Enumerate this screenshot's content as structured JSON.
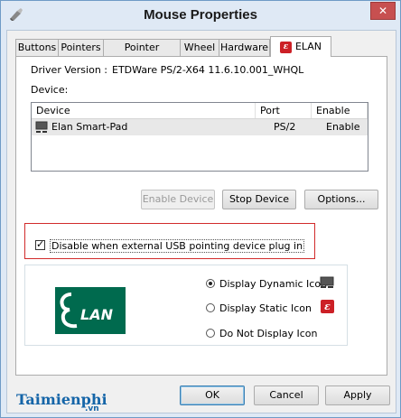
{
  "window": {
    "title": "Mouse Properties",
    "close_glyph": "✕"
  },
  "tabs": [
    {
      "label": "Buttons"
    },
    {
      "label": "Pointers"
    },
    {
      "label": "Pointer Options"
    },
    {
      "label": "Wheel"
    },
    {
      "label": "Hardware"
    },
    {
      "label": "ELAN",
      "icon": "elan-icon",
      "active": true
    }
  ],
  "driver": {
    "label": "Driver Version :",
    "value": "ETDWare PS/2-X64 11.6.10.001_WHQL"
  },
  "device_label": "Device:",
  "device_list": {
    "columns": [
      "Device",
      "Port",
      "Enable"
    ],
    "rows": [
      {
        "device": "Elan Smart-Pad",
        "port": "PS/2",
        "enable": "Enable",
        "icon": "touchpad-icon"
      }
    ]
  },
  "buttons": {
    "enable_device": "Enable Device",
    "stop_device": "Stop Device",
    "options": "Options..."
  },
  "disable_usb": {
    "label": "Disable when external USB pointing device plug in",
    "checked": true
  },
  "icon_options": [
    {
      "label": "Display Dynamic Icon",
      "selected": true
    },
    {
      "label": "Display Static Icon",
      "selected": false
    },
    {
      "label": "Do Not Display Icon",
      "selected": false
    }
  ],
  "footer": {
    "ok": "OK",
    "cancel": "Cancel",
    "apply": "Apply"
  },
  "watermark": {
    "main": "Taimienphi",
    "sub": ".vn"
  },
  "logo": {
    "text": "LAN"
  },
  "colors": {
    "accent": "#006a4e",
    "highlight_border": "#d12b2b",
    "elan_red": "#cc2026"
  }
}
